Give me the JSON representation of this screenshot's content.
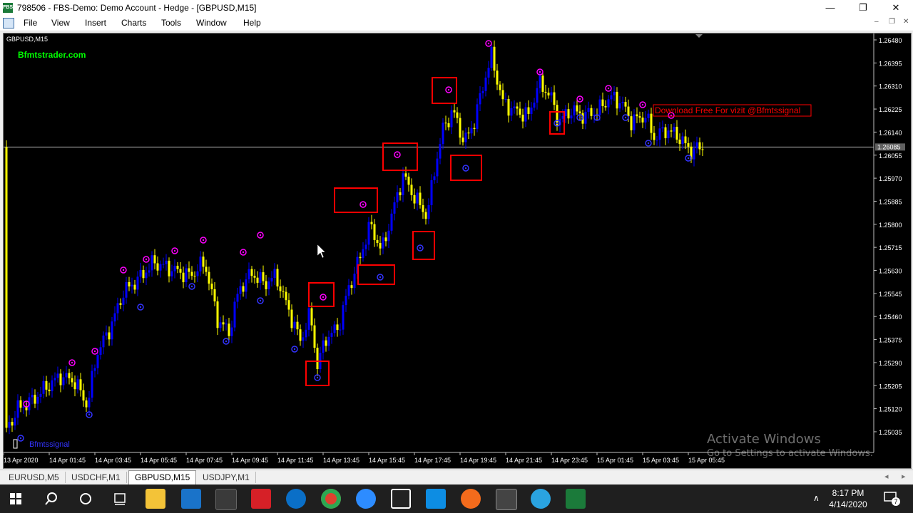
{
  "window": {
    "title": "798506 - FBS-Demo: Demo Account - Hedge - [GBPUSD,M15]",
    "app_icon": "FBS"
  },
  "menu": [
    "File",
    "View",
    "Insert",
    "Charts",
    "Tools",
    "Window",
    "Help"
  ],
  "chart": {
    "symbol_label": "GBPUSD,M15",
    "watermark_top": "Bfmtstrader.com",
    "watermark_bottom": "Bfmtssignal",
    "banner": "Download Free For vizit @Bfmtssignal",
    "current_price": "1.26085",
    "price_levels": [
      "1.26480",
      "1.26395",
      "1.26310",
      "1.26225",
      "1.26140",
      "1.26055",
      "1.25970",
      "1.25885",
      "1.25800",
      "1.25715",
      "1.25630",
      "1.25545",
      "1.25460",
      "1.25375",
      "1.25290",
      "1.25205",
      "1.25120",
      "1.25035"
    ],
    "time_labels": [
      "13 Apr 2020",
      "14 Apr 01:45",
      "14 Apr 03:45",
      "14 Apr 05:45",
      "14 Apr 07:45",
      "14 Apr 09:45",
      "14 Apr 11:45",
      "14 Apr 13:45",
      "14 Apr 15:45",
      "14 Apr 17:45",
      "14 Apr 19:45",
      "14 Apr 21:45",
      "14 Apr 23:45",
      "15 Apr 01:45",
      "15 Apr 03:45",
      "15 Apr 05:45"
    ],
    "colors": {
      "bull": "#0000ff",
      "bear": "#ffff00",
      "top_signal": "#ff00ff",
      "bottom_signal": "#3333ff",
      "box": "#ff0000",
      "watermark": "#00ff00",
      "background": "#000000"
    }
  },
  "activation": {
    "line1": "Activate Windows",
    "line2": "Go to Settings to activate Windows."
  },
  "tabs": [
    {
      "label": "EURUSD,M5",
      "active": false
    },
    {
      "label": "USDCHF,M1",
      "active": false
    },
    {
      "label": "GBPUSD,M15",
      "active": true
    },
    {
      "label": "USDJPY,M1",
      "active": false
    }
  ],
  "taskbar": {
    "time": "8:17 PM",
    "date": "4/14/2020",
    "notification_count": "7",
    "icons": [
      "windows-start-icon",
      "search-icon",
      "cortana-icon",
      "task-view-icon",
      "file-explorer-icon",
      "mail-icon",
      "store-icon",
      "app-icon",
      "edge-icon",
      "chrome-icon",
      "zoom-icon",
      "film-icon",
      "zalo-icon",
      "chart-app-icon",
      "terminal-icon",
      "telegram-icon",
      "fbs-icon"
    ]
  }
}
